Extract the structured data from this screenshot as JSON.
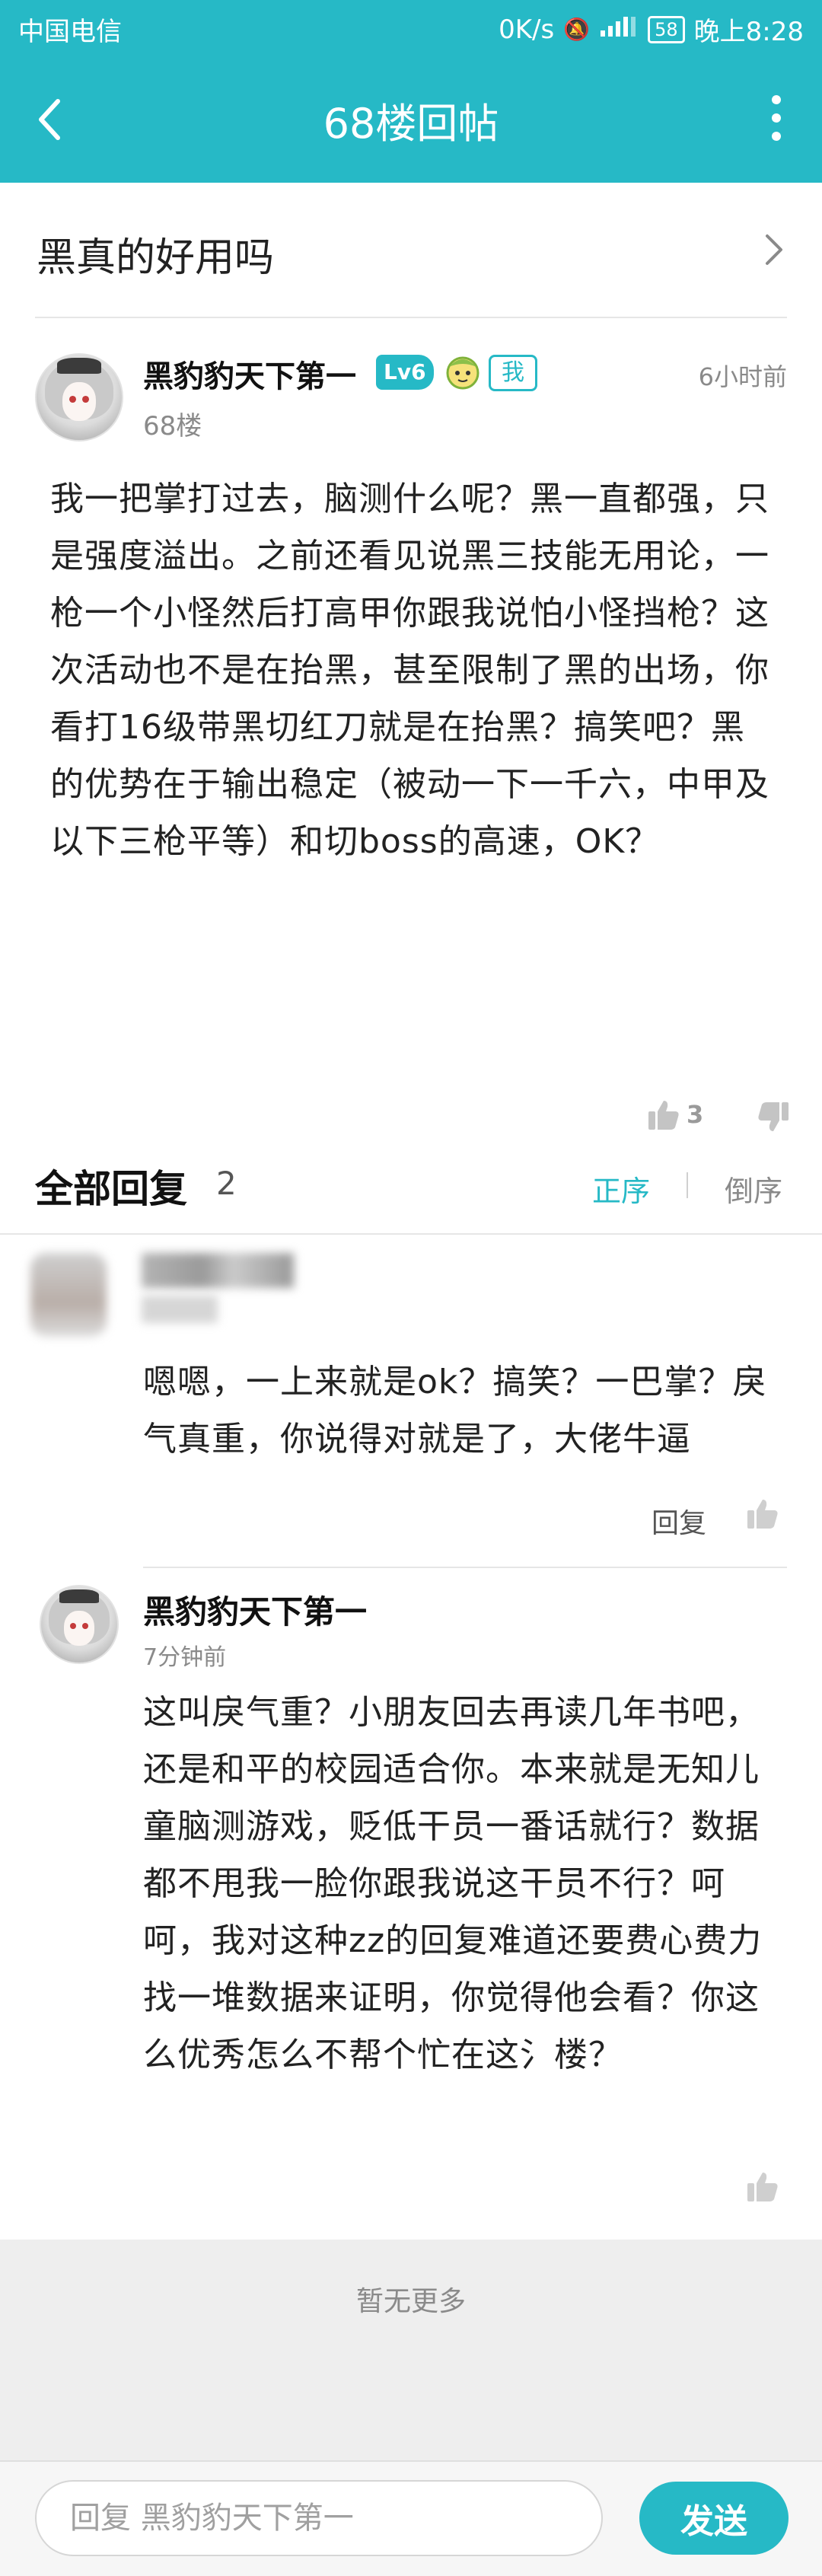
{
  "status_bar": {
    "carrier": "中国电信",
    "speed": "0K/s",
    "battery": "58",
    "time": "晚上8:28"
  },
  "header": {
    "title": "68楼回帖",
    "back_icon": "back-arrow-icon",
    "more_icon": "more-vertical-icon",
    "background_color": "#26b9c6"
  },
  "thread": {
    "title": "黑真的好用吗"
  },
  "post": {
    "author": "黑豹豹天下第一",
    "level": "Lv6",
    "me_badge": "我",
    "time": "6小时前",
    "floor": "68楼",
    "body": "我一把掌打过去，脑测什么呢？黑一直都强，只是强度溢出。之前还看见说黑三技能无用论，一枪一个小怪然后打高甲你跟我说怕小怪挡枪？这次活动也不是在抬黑，甚至限制了黑的出场，你看打16级带黑切红刀就是在抬黑？搞笑吧？黑的优势在于输出稳定（被动一下一千六，中甲及以下三枪平等）和切boss的高速，OK？",
    "like_count": "3"
  },
  "replies_header": {
    "title": "全部回复",
    "count": "2",
    "sort_asc": "正序",
    "sort_desc": "倒序"
  },
  "replies": [
    {
      "text": "嗯嗯，一上来就是ok？搞笑？一巴掌？戾气真重，你说得对就是了，大佬牛逼",
      "reply_label": "回复"
    },
    {
      "author": "黑豹豹天下第一",
      "time": "7分钟前",
      "text": "这叫戾气重？小朋友回去再读几年书吧，还是和平的校园适合你。本来就是无知儿童脑测游戏，贬低干员一番话就行？数据都不甩我一脸你跟我说这干员不行？呵呵，我对这种zz的回复难道还要费心费力找一堆数据来证明，你觉得他会看？你这么优秀怎么不帮个忙在这氵楼？"
    }
  ],
  "footer": {
    "no_more": "暂无更多",
    "input_placeholder": "回复 黑豹豹天下第一",
    "send_label": "发送"
  }
}
